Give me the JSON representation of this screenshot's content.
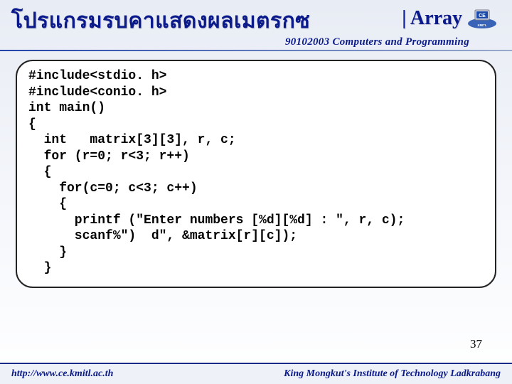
{
  "header": {
    "title_left": "โปรแกรมรบคาแสดงผลเมตรกซ",
    "title_right": "| Array",
    "subtitle": "90102003 Computers and Programming"
  },
  "code": {
    "lines": [
      "#include<stdio. h>",
      "#include<conio. h>",
      "int main()",
      "{",
      "  int   matrix[3][3], r, c;",
      "  for (r=0; r<3; r++)",
      "  {",
      "    for(c=0; c<3; c++)",
      "    {",
      "      printf (\"Enter numbers [%d][%d] : \", r, c);",
      "      scanf%\")  d\", &matrix[r][c]);",
      "    }",
      "  }"
    ]
  },
  "page_number": "37",
  "footer": {
    "left": "http://www.ce.kmitl.ac.th",
    "right": "King Mongkut's Institute of Technology Ladkrabang"
  },
  "logo": {
    "name": "ce-kmitl-logo"
  }
}
